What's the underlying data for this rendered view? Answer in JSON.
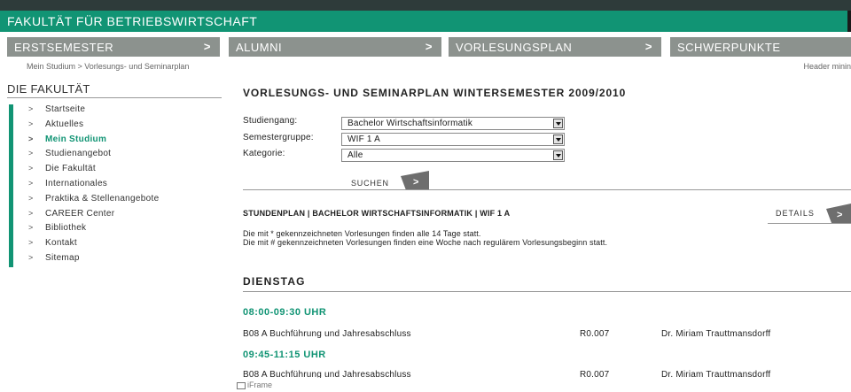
{
  "header": {
    "faculty_title": "FAKULTÄT FÜR BETRIEBSWIRTSCHAFT"
  },
  "colors": {
    "accent": "#119474",
    "nav_bg": "#8c928e",
    "chevron": "#6e6e6e"
  },
  "nav": {
    "tabs": [
      {
        "label": "ERSTSEMESTER",
        "icon": "chevron-right-icon"
      },
      {
        "label": "ALUMNI",
        "icon": "chevron-right-icon"
      },
      {
        "label": "VORLESUNGSPLAN",
        "icon": "chevron-right-icon"
      },
      {
        "label": "SCHWERPUNKTE",
        "icon": ""
      }
    ]
  },
  "breadcrumb": "Mein Studium > Vorlesungs- und Seminarplan",
  "header_hint": "Header minin",
  "sidebar": {
    "title": "DIE FAKULTÄT",
    "bullet": ">",
    "items": [
      {
        "label": "Startseite",
        "active": false
      },
      {
        "label": "Aktuelles",
        "active": false
      },
      {
        "label": "Mein Studium",
        "active": true
      },
      {
        "label": "Studienangebot",
        "active": false
      },
      {
        "label": "Die Fakultät",
        "active": false
      },
      {
        "label": "Internationales",
        "active": false
      },
      {
        "label": "Praktika & Stellenangebote",
        "active": false
      },
      {
        "label": "CAREER Center",
        "active": false
      },
      {
        "label": "Bibliothek",
        "active": false
      },
      {
        "label": "Kontakt",
        "active": false
      },
      {
        "label": "Sitemap",
        "active": false
      }
    ]
  },
  "main": {
    "title": "VORLESUNGS- UND SEMINARPLAN WINTERSEMESTER 2009/2010",
    "filters": {
      "studiengang_label": "Studiengang:",
      "studiengang_value": "Bachelor Wirtschaftsinformatik",
      "semestergruppe_label": "Semestergruppe:",
      "semestergruppe_value": "WIF 1 A",
      "kategorie_label": "Kategorie:",
      "kategorie_value": "Alle"
    },
    "search_label": "SUCHEN",
    "plan_heading": "STUNDENPLAN | BACHELOR WIRTSCHAFTSINFORMATIK | WIF 1 A",
    "details_label": "DETAILS",
    "note_1": "Die mit * gekennzeichneten Vorlesungen finden alle 14 Tage statt.",
    "note_2": "Die mit # gekennzeichneten Vorlesungen finden eine Woche nach regulärem Vorlesungsbeginn statt.",
    "day": "DIENSTAG",
    "slots": [
      {
        "time": "08:00-09:30 UHR",
        "course": "B08 A Buchführung und Jahresabschluss",
        "room": "R0.007",
        "lecturer": "Dr. Miriam Trauttmansdorff"
      },
      {
        "time": "09:45-11:15 UHR",
        "course": "B08 A Buchführung und Jahresabschluss",
        "room": "R0.007",
        "lecturer": "Dr. Miriam Trauttmansdorff"
      }
    ]
  },
  "footer": {
    "iframe_label": "iFrame"
  }
}
